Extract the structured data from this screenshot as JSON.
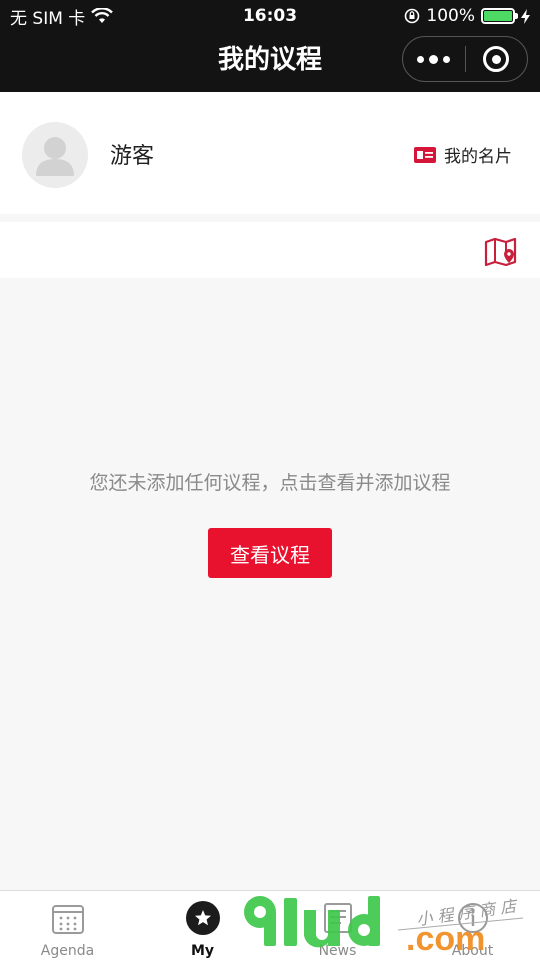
{
  "status_bar": {
    "carrier": "无 SIM 卡",
    "time": "16:03",
    "battery": "100%",
    "battery_level": 1.0
  },
  "nav": {
    "title": "我的议程"
  },
  "profile": {
    "name": "游客",
    "card_label": "我的名片"
  },
  "empty": {
    "message": "您还未添加任何议程，点击查看并添加议程",
    "button_label": "查看议程"
  },
  "tabs": [
    {
      "label": "Agenda",
      "icon": "calendar-icon",
      "active": false
    },
    {
      "label": "My",
      "icon": "star-icon",
      "active": true
    },
    {
      "label": "News",
      "icon": "news-icon",
      "active": false
    },
    {
      "label": "About",
      "icon": "about-icon",
      "active": false
    }
  ],
  "watermark": {
    "brand": "91ud.com",
    "tagline": "小程序商店"
  },
  "colors": {
    "accent": "#e8112e",
    "header_bg": "#131313",
    "page_bg": "#f7f7f7"
  }
}
